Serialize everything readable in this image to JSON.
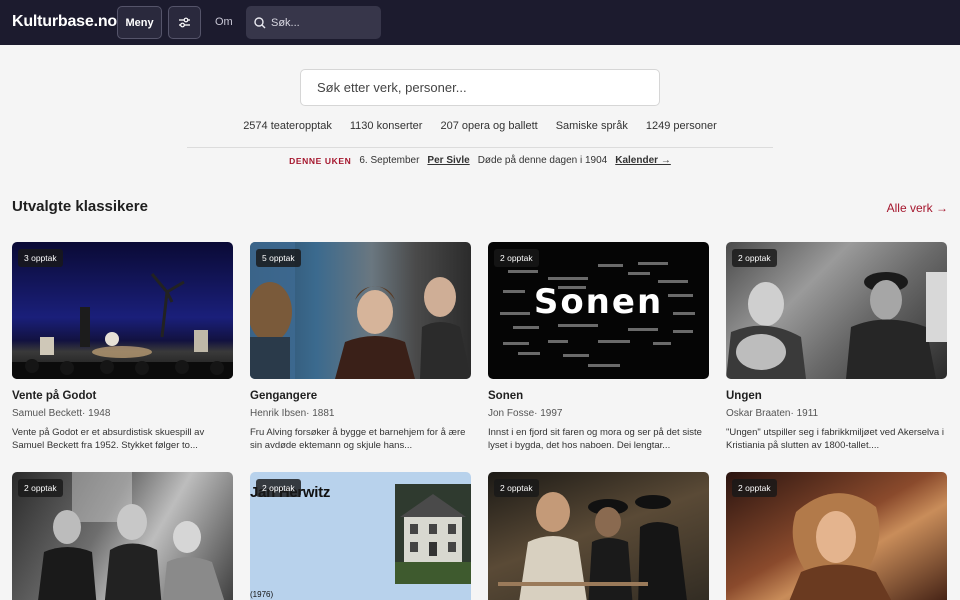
{
  "header": {
    "logo": "Kulturbase.no",
    "menu_label": "Meny",
    "filter_icon": "sliders-icon",
    "about_label": "Om",
    "search_placeholder": "Søk..."
  },
  "hero": {
    "search_placeholder": "Søk etter verk, personer...",
    "stats": [
      "2574 teateropptak",
      "1130 konserter",
      "207 opera og ballett",
      "Samiske språk",
      "1249 personer"
    ]
  },
  "this_week": {
    "tag": "DENNE UKEN",
    "date": "6. September",
    "person": "Per Sivle",
    "note": "Døde på denne dagen i 1904",
    "calendar_link": "Kalender →"
  },
  "section": {
    "title": "Utvalgte klassikere",
    "all_link": "Alle verk →"
  },
  "cards": [
    {
      "badge": "3 opptak",
      "title": "Vente på Godot",
      "meta": "Samuel Beckett· 1948",
      "desc": "Vente på Godot er et absurdistisk skuespill av Samuel Beckett fra 1952. Stykket følger to..."
    },
    {
      "badge": "5 opptak",
      "title": "Gengangere",
      "meta": "Henrik Ibsen· 1881",
      "desc": "Fru Alving forsøker å bygge et barnehjem for å ære sin avdøde ektemann og skjule hans..."
    },
    {
      "badge": "2 opptak",
      "title": "Sonen",
      "meta": "Jon Fosse· 1997",
      "desc": "Innst i en fjord sit faren og mora og ser på det siste lyset i bygda, det hos naboen. Dei lengtar...",
      "poster_text": "Sonen"
    },
    {
      "badge": "2 opptak",
      "title": "Ungen",
      "meta": "Oskar Braaten· 1911",
      "desc": "\"Ungen\" utspiller seg i fabrikkmiljøet ved Akerselva i Kristiania på slutten av 1800-tallet...."
    },
    {
      "badge": "2 opptak"
    },
    {
      "badge": "2 opptak",
      "poster_text": "Jan Herwitz",
      "poster_year": "(1976)"
    },
    {
      "badge": "2 opptak"
    },
    {
      "badge": "2 opptak"
    }
  ]
}
